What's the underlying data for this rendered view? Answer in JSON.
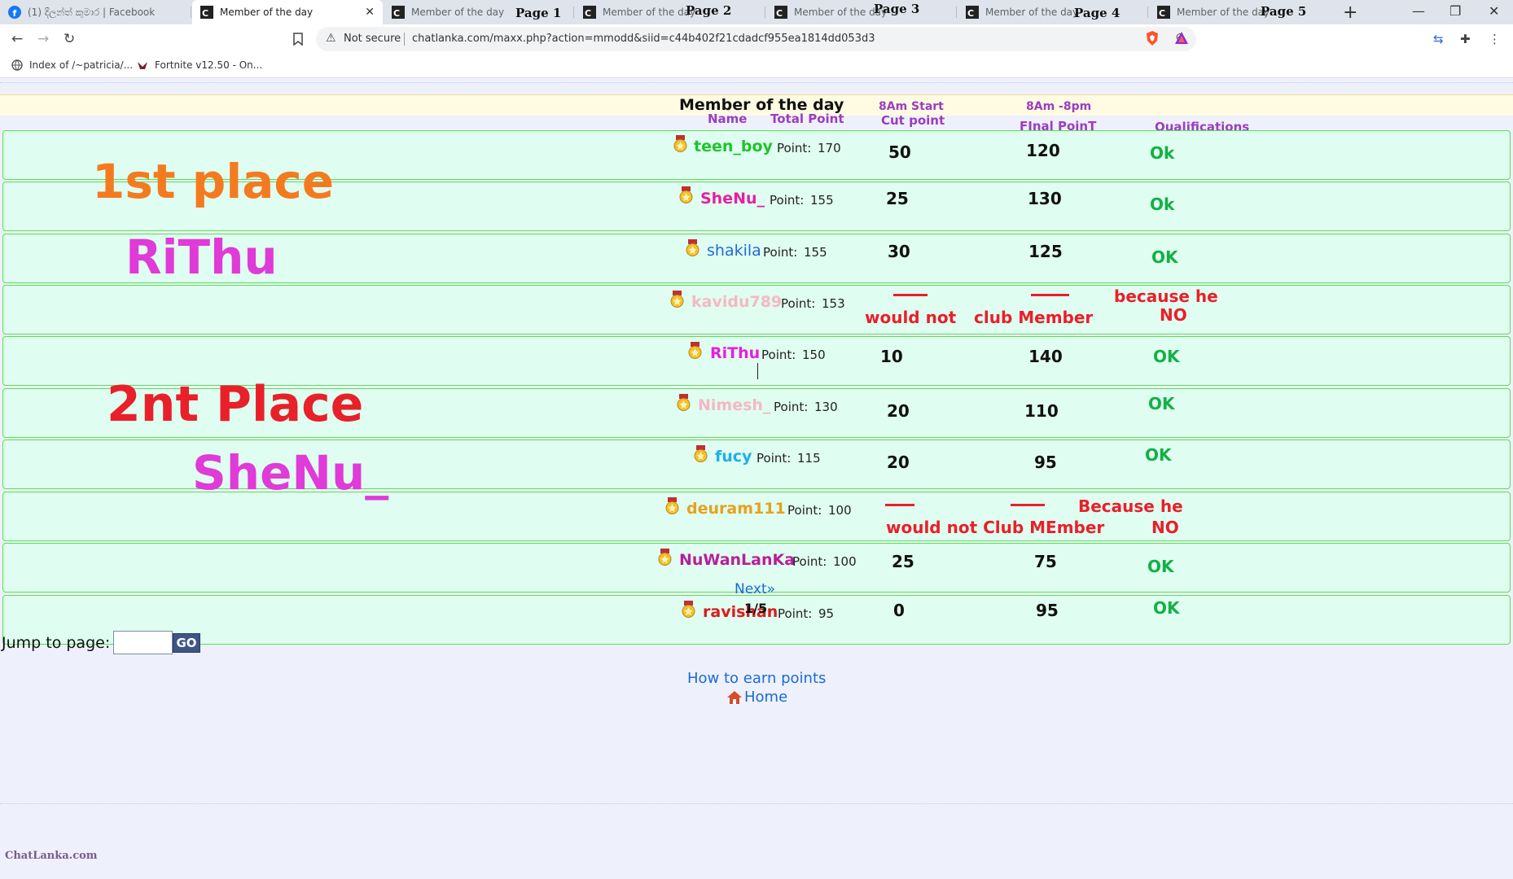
{
  "tabs": [
    {
      "title": "(1) දිලන්ත් කුමාර | Facebook",
      "page": "",
      "active": false
    },
    {
      "title": "Member of the day",
      "page": "",
      "active": true
    },
    {
      "title": "Member of the day",
      "page": "Page 1",
      "active": false
    },
    {
      "title": "Member of the day",
      "page": "Page 2",
      "active": false
    },
    {
      "title": "Member of the day",
      "page": "Page 3",
      "active": false
    },
    {
      "title": "Member of the day",
      "page": "Page 4",
      "active": false
    },
    {
      "title": "Member of the day",
      "page": "Page 5",
      "active": false
    }
  ],
  "address": {
    "security": "Not secure",
    "url": "chatlanka.com/maxx.php?action=mmodd&siid=c44b402f21cdadcf955ea1814dd053d3"
  },
  "bookmarks": [
    "Index of /~patricia/...",
    "Fortnite v12.50 - On..."
  ],
  "header": {
    "title": "Member of the day",
    "name_col": "Name",
    "total_col": "Total Point",
    "start_col": "8Am Start",
    "cut_col": "Cut point",
    "range_col": "8Am -8pm",
    "final_col": "FInal PoinT",
    "qual_col": "Qualifications"
  },
  "point_label": "Point:",
  "rows": [
    {
      "name": "teen_boy",
      "color": "#1ec42a",
      "points": "170",
      "cut": "50",
      "final": "120",
      "qual": "Ok"
    },
    {
      "name": "SheNu_",
      "color": "#e81ea0",
      "points": "155",
      "cut": "25",
      "final": "130",
      "qual": "Ok"
    },
    {
      "name": "shakila",
      "color": "#1e6ad6",
      "points": "155",
      "cut": "30",
      "final": "125",
      "qual": "OK"
    },
    {
      "name": "kavidu789",
      "color": "#f5b8c4",
      "points": "153",
      "cut_text": "would not",
      "final_text": "club Member",
      "reason": "because   he",
      "qual": "NO"
    },
    {
      "name": "RiThu",
      "color": "#e81ee0",
      "points": "150",
      "cut": "10",
      "final": "140",
      "qual": "OK"
    },
    {
      "name": "Nimesh_",
      "color": "#f5b8c4",
      "points": "130",
      "cut": "20",
      "final": "110",
      "qual": "OK"
    },
    {
      "name": "fucy",
      "color": "#1eaee8",
      "points": "115",
      "cut": "20",
      "final": "95",
      "qual": "OK"
    },
    {
      "name": "deuram111",
      "color": "#e8a01e",
      "points": "100",
      "cut_text": "would not Club MEmber",
      "reason": "Because he",
      "qual": "NO"
    },
    {
      "name": "NuWanLanKa",
      "color": "#b81e9a",
      "points": "100",
      "cut": "25",
      "final": "75",
      "qual": "OK"
    },
    {
      "name": "ravishan",
      "color": "#d81e1e",
      "points": "95",
      "cut": "0",
      "final": "95",
      "qual": "OK"
    }
  ],
  "overlays": {
    "first_place": "1st place",
    "first_name": "RiThu",
    "second_place": "2nt Place",
    "second_name": "SheNu_"
  },
  "colors": {
    "first_place": "#f47a20",
    "first_name": "#e03ad8",
    "second_place": "#e8202a",
    "second_name": "#e03ad8"
  },
  "pager": {
    "next": "Next»",
    "page": "1/5",
    "jump_label": "Jump to page:",
    "jump_value": "",
    "go": "GO"
  },
  "footer": {
    "earn": "How to earn points",
    "home": "Home",
    "logo": "ChatLanka.com"
  }
}
